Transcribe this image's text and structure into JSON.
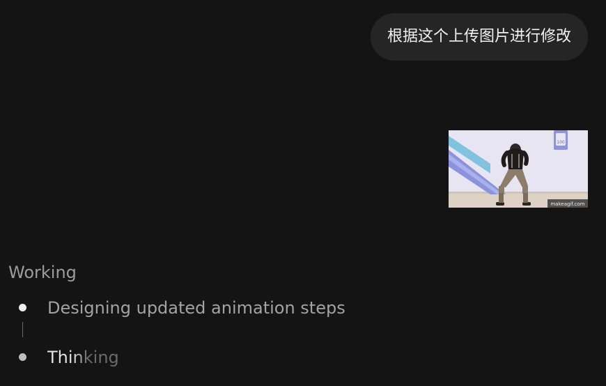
{
  "user_message": {
    "text": "根据这个上传图片进行修改"
  },
  "attachment": {
    "watermark": "makeagif.com",
    "sign_number": "100"
  },
  "status": {
    "heading": "Working",
    "steps": [
      {
        "label": "Designing updated animation steps",
        "state": "done"
      },
      {
        "label": "Thinking",
        "state": "active"
      }
    ]
  },
  "colors": {
    "background": "#141414",
    "bubble": "#252525",
    "muted_text": "#9c9c9c"
  }
}
